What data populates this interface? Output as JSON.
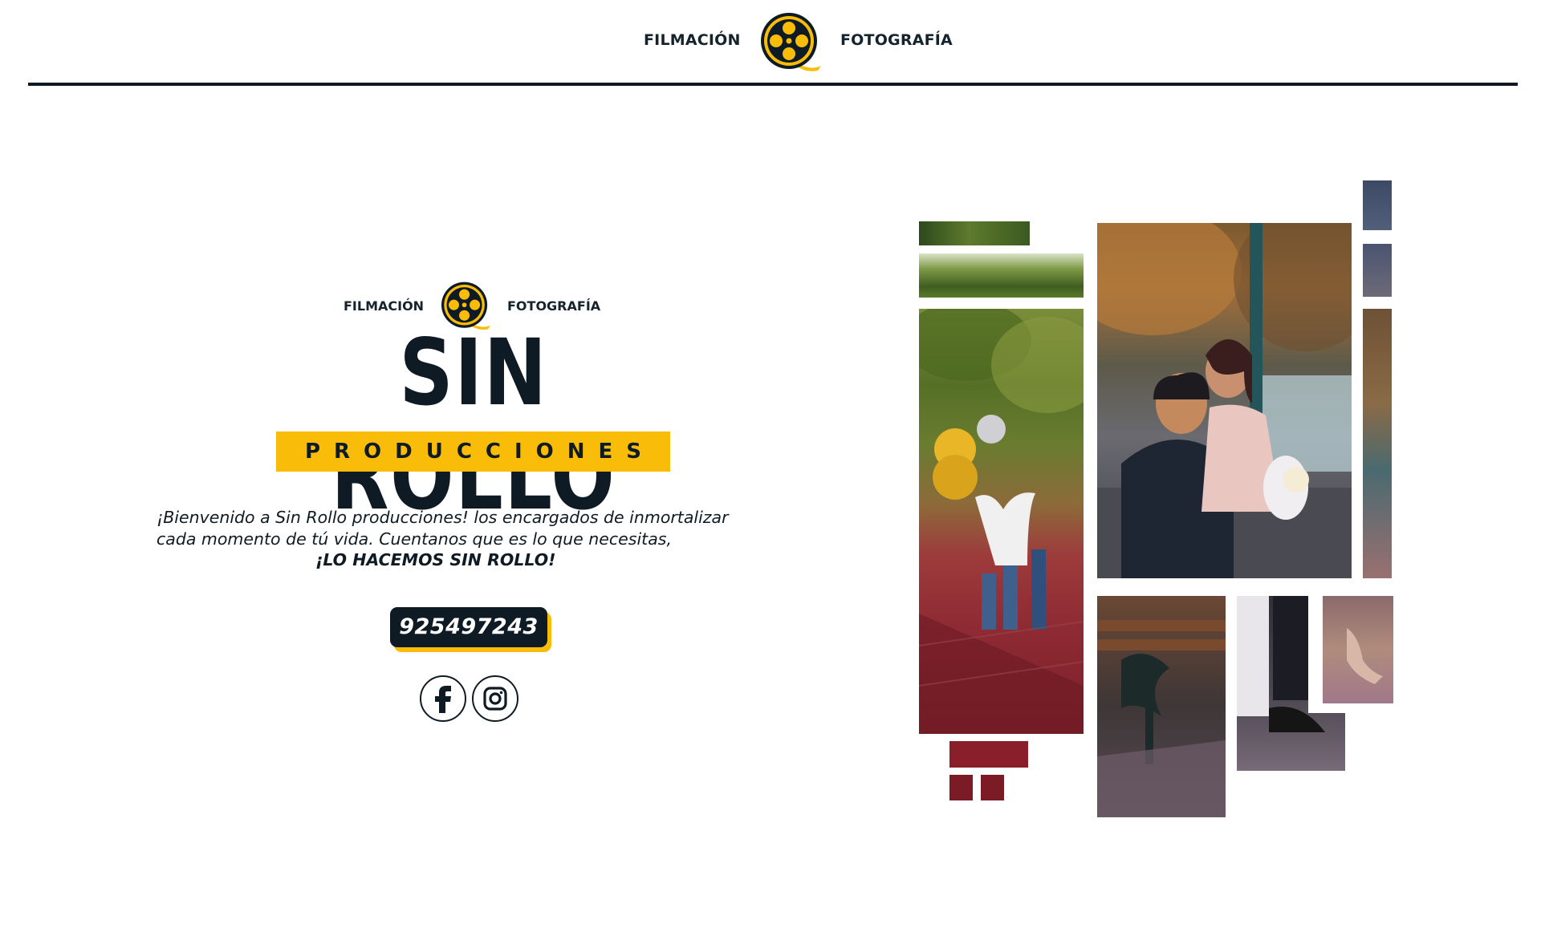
{
  "header": {
    "nav_left": "FILMACIÓN",
    "nav_right": "FOTOGRAFÍA",
    "logo_icon": "film-reel-icon"
  },
  "brand": {
    "small_left": "FILMACIÓN",
    "small_right": "FOTOGRAFÍA",
    "title": "SIN ROLLO",
    "subtitle": "PRODUCCIONES"
  },
  "welcome": {
    "line1": "¡Bienvenido a Sin Rollo producciones! los encargados de inmortalizar",
    "line2": "cada momento de tú vida. Cuentanos que es lo que necesitas,",
    "motto": "¡LO HACEMOS SIN ROLLO!"
  },
  "contact": {
    "phone": "925497243"
  },
  "social": [
    {
      "icon": "facebook-icon"
    },
    {
      "icon": "instagram-icon"
    }
  ],
  "colors": {
    "navy": "#0f1b24",
    "accent_yellow": "#f9bd09",
    "background": "#ffffff"
  }
}
